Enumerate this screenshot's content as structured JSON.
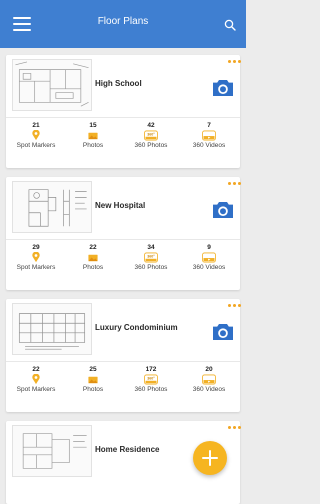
{
  "header": {
    "title": "Floor Plans"
  },
  "plans": [
    {
      "name": "High School",
      "stats": [
        {
          "count": "21",
          "label": "Spot Markers",
          "icon": "pin-icon"
        },
        {
          "count": "15",
          "label": "Photos",
          "icon": "photo-icon"
        },
        {
          "count": "42",
          "label": "360 Photos",
          "icon": "360-photo-icon"
        },
        {
          "count": "7",
          "label": "360 Videos",
          "icon": "360-video-icon"
        }
      ]
    },
    {
      "name": "New Hospital",
      "stats": [
        {
          "count": "29",
          "label": "Spot Markers",
          "icon": "pin-icon"
        },
        {
          "count": "22",
          "label": "Photos",
          "icon": "photo-icon"
        },
        {
          "count": "34",
          "label": "360 Photos",
          "icon": "360-photo-icon"
        },
        {
          "count": "9",
          "label": "360 Videos",
          "icon": "360-video-icon"
        }
      ]
    },
    {
      "name": "Luxury Condominium",
      "stats": [
        {
          "count": "22",
          "label": "Spot Markers",
          "icon": "pin-icon"
        },
        {
          "count": "25",
          "label": "Photos",
          "icon": "photo-icon"
        },
        {
          "count": "172",
          "label": "360 Photos",
          "icon": "360-photo-icon"
        },
        {
          "count": "20",
          "label": "360 Videos",
          "icon": "360-video-icon"
        }
      ]
    },
    {
      "name": "Home Residence",
      "stats": []
    }
  ],
  "colors": {
    "app_bar": "#3f7fd1",
    "accent": "#f6b521",
    "camera": "#2f6fc7",
    "background": "#ececec"
  },
  "badges": {
    "photo360": "360°"
  }
}
